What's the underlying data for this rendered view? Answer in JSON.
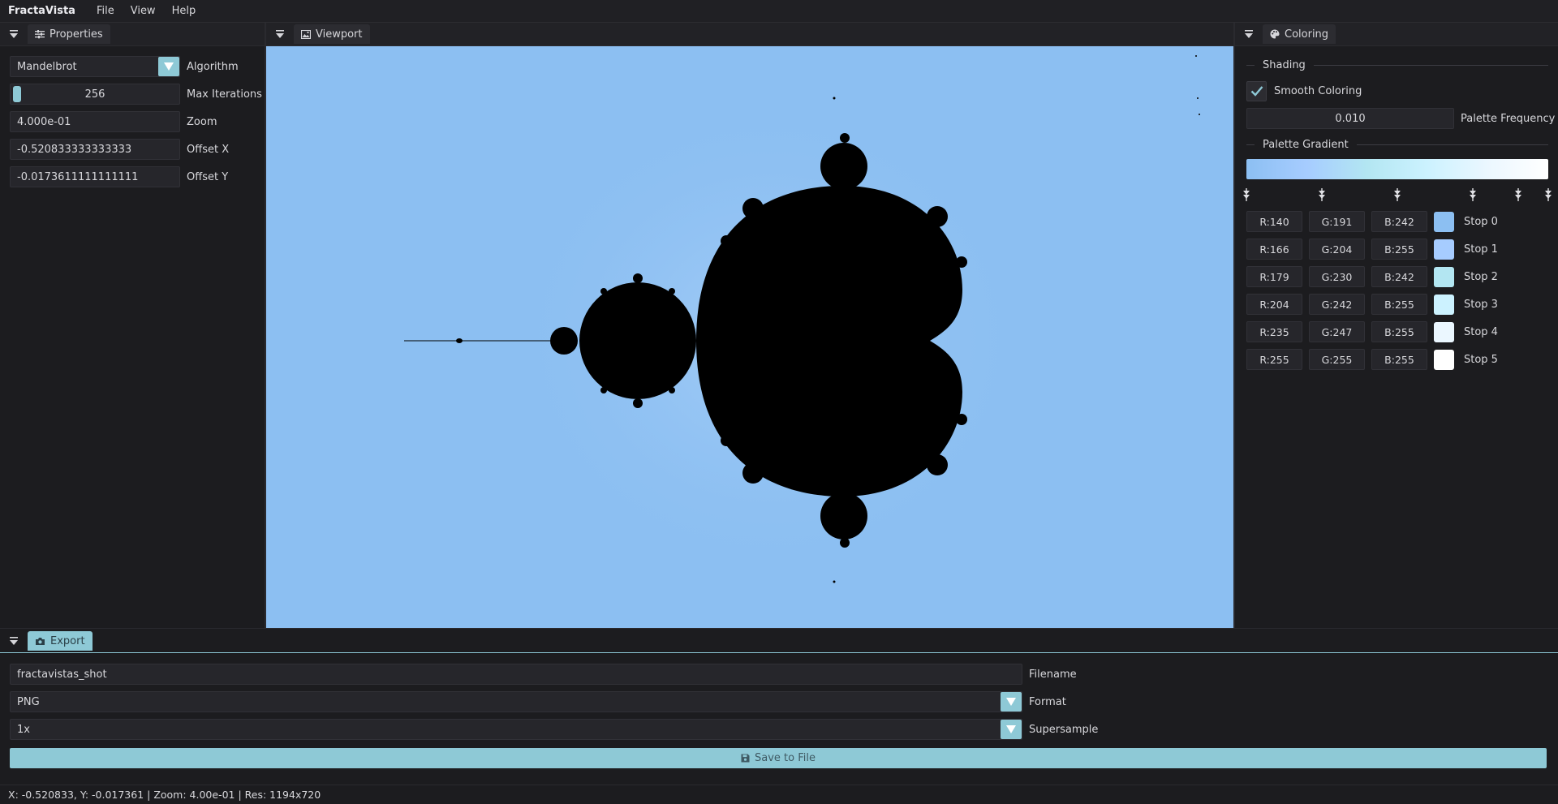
{
  "menubar": {
    "app_title": "FractaVista",
    "items": [
      "File",
      "View",
      "Help"
    ]
  },
  "properties": {
    "tab_label": "Properties",
    "algorithm": {
      "value": "Mandelbrot",
      "label": "Algorithm"
    },
    "max_iterations": {
      "value": "256",
      "label": "Max Iterations"
    },
    "zoom": {
      "value": "4.000e-01",
      "label": "Zoom"
    },
    "offset_x": {
      "value": "-0.520833333333333",
      "label": "Offset X"
    },
    "offset_y": {
      "value": "-0.0173611111111111",
      "label": "Offset Y"
    }
  },
  "viewport": {
    "tab_label": "Viewport"
  },
  "coloring": {
    "tab_label": "Coloring",
    "shading_heading": "Shading",
    "smooth_coloring": {
      "label": "Smooth Coloring",
      "checked": true
    },
    "palette_frequency": {
      "value": "0.010",
      "label": "Palette Frequency"
    },
    "palette_gradient_heading": "Palette Gradient",
    "stops": [
      {
        "r": "R:140",
        "g": "G:191",
        "b": "B:242",
        "label": "Stop 0",
        "color": "#8cbff2"
      },
      {
        "r": "R:166",
        "g": "G:204",
        "b": "B:255",
        "label": "Stop 1",
        "color": "#a6ccff"
      },
      {
        "r": "R:179",
        "g": "G:230",
        "b": "B:242",
        "label": "Stop 2",
        "color": "#b3e6f2"
      },
      {
        "r": "R:204",
        "g": "G:242",
        "b": "B:255",
        "label": "Stop 3",
        "color": "#ccf2ff"
      },
      {
        "r": "R:235",
        "g": "G:247",
        "b": "B:255",
        "label": "Stop 4",
        "color": "#ebf7ff"
      },
      {
        "r": "R:255",
        "g": "G:255",
        "b": "B:255",
        "label": "Stop 5",
        "color": "#ffffff"
      }
    ]
  },
  "export": {
    "tab_label": "Export",
    "filename": {
      "value": "fractavistas_shot",
      "label": "Filename"
    },
    "format": {
      "value": "PNG",
      "label": "Format"
    },
    "supersample": {
      "value": "1x",
      "label": "Supersample"
    },
    "save_label": "Save to File"
  },
  "status": {
    "text": "X: -0.520833, Y: -0.017361 | Zoom: 4.00e-01 | Res: 1194x720"
  },
  "colors": {
    "accent": "#8ec9d6",
    "background": "#1c1c1f",
    "fractal_bg": "#8cbff2"
  }
}
